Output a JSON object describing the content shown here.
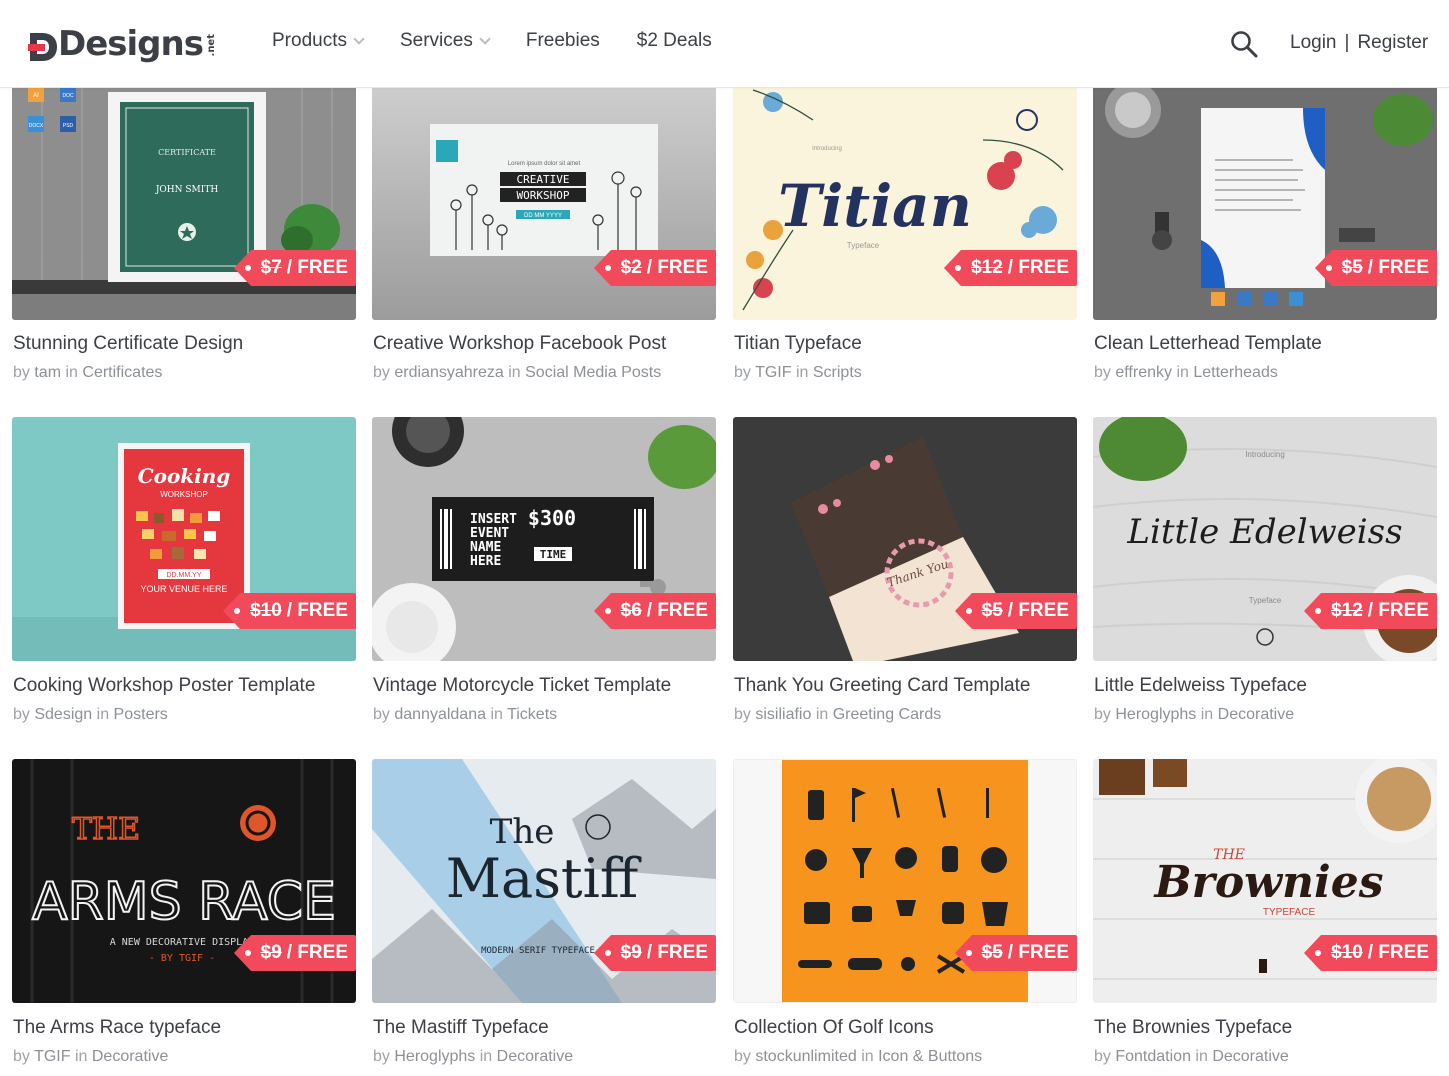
{
  "header": {
    "logo_text": "Designs",
    "logo_suffix": ".net",
    "nav": [
      {
        "label": "Products",
        "has_dropdown": true
      },
      {
        "label": "Services",
        "has_dropdown": true
      },
      {
        "label": "Freebies",
        "has_dropdown": false
      },
      {
        "label": "$2 Deals",
        "has_dropdown": false
      }
    ],
    "login_label": "Login",
    "separator": "|",
    "register_label": "Register"
  },
  "colors": {
    "accent": "#f04a5b",
    "text": "#3c3f45",
    "muted": "#9da1a6"
  },
  "cards": [
    {
      "title": "Stunning Certificate Design",
      "old_price": "$7",
      "price_label": "/ FREE",
      "by": "by",
      "author": "tam",
      "in": "in",
      "category": "Certificates"
    },
    {
      "title": "Creative Workshop Facebook Post",
      "old_price": "$2",
      "price_label": "/ FREE",
      "by": "by",
      "author": "erdiansyahreza",
      "in": "in",
      "category": "Social Media Posts"
    },
    {
      "title": "Titian Typeface",
      "old_price": "$12",
      "price_label": "/ FREE",
      "by": "by",
      "author": "TGIF",
      "in": "in",
      "category": "Scripts"
    },
    {
      "title": "Clean Letterhead Template",
      "old_price": "$5",
      "price_label": "/ FREE",
      "by": "by",
      "author": "effrenky",
      "in": "in",
      "category": "Letterheads"
    },
    {
      "title": "Cooking Workshop Poster Template",
      "old_price": "$10",
      "price_label": "/ FREE",
      "by": "by",
      "author": "Sdesign",
      "in": "in",
      "category": "Posters"
    },
    {
      "title": "Vintage Motorcycle Ticket Template",
      "old_price": "$6",
      "price_label": "/ FREE",
      "by": "by",
      "author": "dannyaldana",
      "in": "in",
      "category": "Tickets"
    },
    {
      "title": "Thank You Greeting Card Template",
      "old_price": "$5",
      "price_label": "/ FREE",
      "by": "by",
      "author": "sisiliafio",
      "in": "in",
      "category": "Greeting Cards"
    },
    {
      "title": "Little Edelweiss Typeface",
      "old_price": "$12",
      "price_label": "/ FREE",
      "by": "by",
      "author": "Heroglyphs",
      "in": "in",
      "category": "Decorative"
    },
    {
      "title": "The Arms Race typeface",
      "old_price": "$9",
      "price_label": "/ FREE",
      "by": "by",
      "author": "TGIF",
      "in": "in",
      "category": "Decorative"
    },
    {
      "title": "The Mastiff Typeface",
      "old_price": "$9",
      "price_label": "/ FREE",
      "by": "by",
      "author": "Heroglyphs",
      "in": "in",
      "category": "Decorative"
    },
    {
      "title": "Collection Of Golf Icons",
      "old_price": "$5",
      "price_label": "/ FREE",
      "by": "by",
      "author": "stockunlimited",
      "in": "in",
      "category": "Icon & Buttons"
    },
    {
      "title": "The Brownies Typeface",
      "old_price": "$10",
      "price_label": "/ FREE",
      "by": "by",
      "author": "Fontdation",
      "in": "in",
      "category": "Decorative"
    }
  ],
  "thumb_text": {
    "c0": {
      "l1": "CERTIFICATE",
      "l2": "JOHN SMITH",
      "f1": "AI",
      "f2": "DOC",
      "f3": "DOCX",
      "f4": "PSD"
    },
    "c1": {
      "l1": "Lorem ipsum dolor sit amet",
      "l2": "CREATIVE",
      "l3": "WORKSHOP",
      "l4": "DD MM YYYY"
    },
    "c2": {
      "l1": "Introducing",
      "l2": "Titian",
      "l3": "Typeface"
    },
    "c4": {
      "l1": "Cooking",
      "l2": "WORKSHOP",
      "l3": "DD.MM.YY",
      "l4": "YOUR VENUE HERE"
    },
    "c5": {
      "l1": "INSERT",
      "l2": "EVENT",
      "l3": "NAME",
      "l4": "HERE",
      "l5": "$300",
      "l6": "TIME"
    },
    "c6": {
      "l1": "Thank You"
    },
    "c7": {
      "l1": "Introducing",
      "l2": "Little Edelweiss",
      "l3": "Typeface"
    },
    "c8": {
      "l1": "THE",
      "l2": "ARMS RACE",
      "l3": "A NEW DECORATIVE DISPLAY",
      "l4": "- BY TGIF -"
    },
    "c9": {
      "l1": "The",
      "l2": "Mastiff",
      "l3": "MODERN SERIF TYPEFACE"
    },
    "c11": {
      "l1": "THE",
      "l2": "Brownies",
      "l3": "TYPEFACE"
    }
  }
}
